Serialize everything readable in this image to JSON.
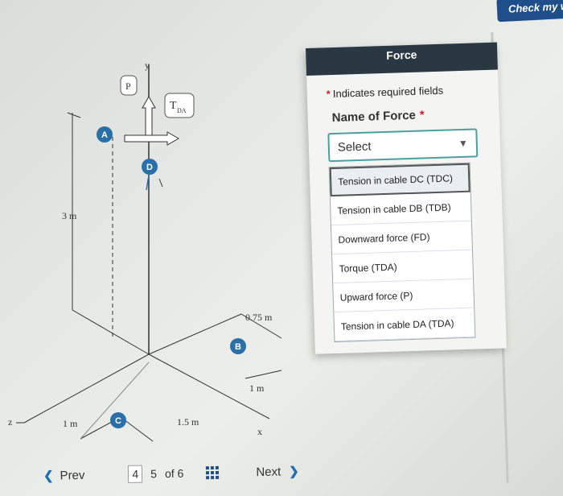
{
  "header": {
    "check_button": "Check my w"
  },
  "panel": {
    "title": "Force",
    "required_note": "Indicates required fields",
    "field_label": "Name of Force",
    "select_value": "Select",
    "options": [
      {
        "label": "Tension in cable DC (TDC)"
      },
      {
        "label": "Tension in cable DB (TDB)"
      },
      {
        "label": "Downward force (FD)"
      },
      {
        "label": "Torque (TDA)"
      },
      {
        "label": "Upward force (P)"
      },
      {
        "label": "Tension in cable DA (TDA)"
      }
    ]
  },
  "diagram": {
    "points": {
      "A": "A",
      "B": "B",
      "C": "C",
      "D": "D"
    },
    "labels": {
      "P": "P",
      "T": "T",
      "T_sub": "DA",
      "y": "y",
      "x": "x",
      "z": "z",
      "h3": "3 m",
      "d075": "0.75 m",
      "d1a": "1 m",
      "d15": "1.5 m",
      "d1b": "1 m"
    }
  },
  "footer": {
    "prev": "Prev",
    "pages": [
      "4",
      "5"
    ],
    "of": "of 6",
    "next": "Next"
  }
}
